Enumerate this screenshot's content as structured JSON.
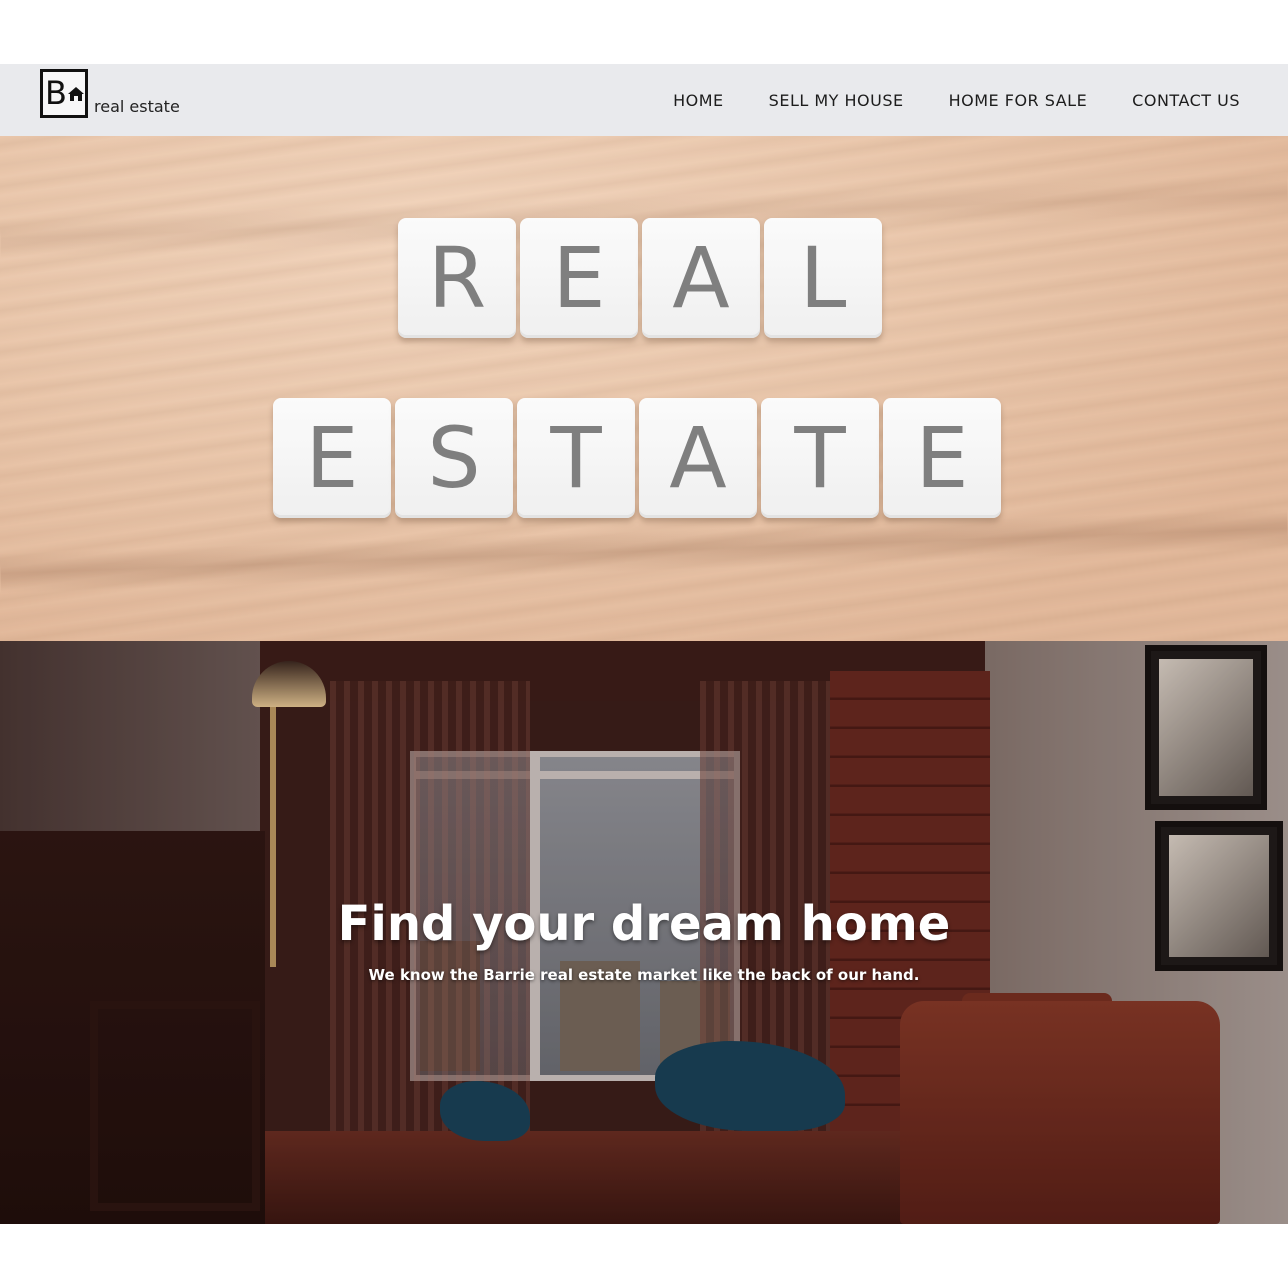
{
  "brand": {
    "logo_letter": "B",
    "logo_text": "real estate"
  },
  "nav": {
    "items": [
      {
        "label": "HOME"
      },
      {
        "label": "SELL MY HOUSE"
      },
      {
        "label": "HOME FOR SALE"
      },
      {
        "label": "CONTACT US"
      }
    ]
  },
  "hero_tiles": {
    "row1": [
      "R",
      "E",
      "A",
      "L"
    ],
    "row2": [
      "E",
      "S",
      "T",
      "A",
      "T",
      "E"
    ]
  },
  "hero": {
    "title": "Find your dream home",
    "subtitle": "We know the Barrie real estate market like the back of our hand."
  },
  "colors": {
    "nav_background": "#e9eaed",
    "nav_text": "#1d1d1d",
    "hero_text": "#ffffff",
    "tile_letter": "#6e6e6e"
  }
}
